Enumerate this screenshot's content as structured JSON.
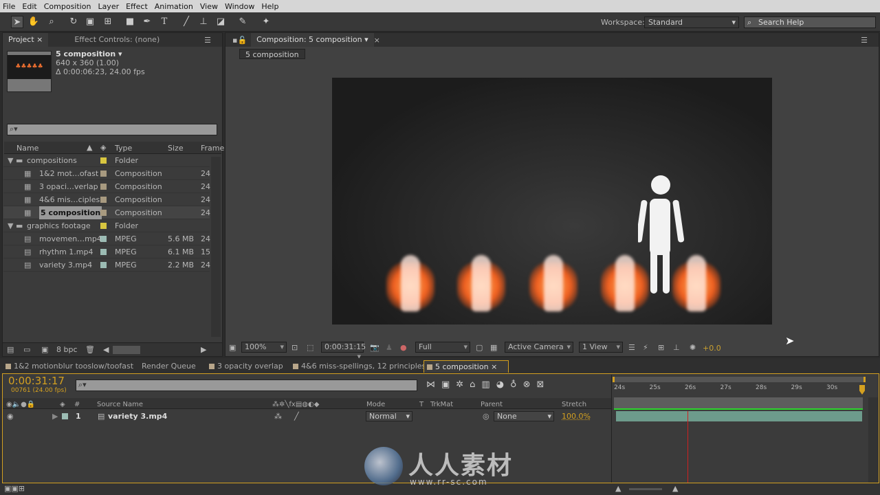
{
  "menu": [
    "File",
    "Edit",
    "Composition",
    "Layer",
    "Effect",
    "Animation",
    "View",
    "Window",
    "Help"
  ],
  "toolbar": {
    "workspace_label": "Workspace:",
    "workspace_value": "Standard",
    "search_placeholder": "Search Help"
  },
  "project_panel": {
    "tabs": [
      "Project",
      "Effect Controls: (none)"
    ],
    "selected_name": "5 composition ▾",
    "selected_dims": "640 x 360 (1.00)",
    "selected_duration": "Δ 0:00:06:23, 24.00 fps",
    "columns": [
      "Name",
      "Type",
      "Size",
      "Frame"
    ],
    "items": [
      {
        "name": "compositions",
        "type": "Folder",
        "size": "",
        "frame": "",
        "kind": "folder",
        "color": "#d8c640"
      },
      {
        "name": "1&2 mot…ofast",
        "type": "Composition",
        "size": "",
        "frame": "24",
        "kind": "comp",
        "color": "#a89a80"
      },
      {
        "name": "3 opaci…verlap",
        "type": "Composition",
        "size": "",
        "frame": "24",
        "kind": "comp",
        "color": "#a89a80"
      },
      {
        "name": "4&6 mis…ciples",
        "type": "Composition",
        "size": "",
        "frame": "24",
        "kind": "comp",
        "color": "#a89a80"
      },
      {
        "name": "5 composition",
        "type": "Composition",
        "size": "",
        "frame": "24",
        "kind": "comp",
        "color": "#a89a80",
        "selected": true
      },
      {
        "name": "graphics footage",
        "type": "Folder",
        "size": "",
        "frame": "",
        "kind": "folder",
        "color": "#d8c640"
      },
      {
        "name": "movemen…mp4",
        "type": "MPEG",
        "size": "5.6 MB",
        "frame": "24",
        "kind": "file",
        "color": "#9cbcb4"
      },
      {
        "name": "rhythm 1.mp4",
        "type": "MPEG",
        "size": "6.1 MB",
        "frame": "15",
        "kind": "file",
        "color": "#9cbcb4"
      },
      {
        "name": "variety 3.mp4",
        "type": "MPEG",
        "size": "2.2 MB",
        "frame": "24",
        "kind": "file",
        "color": "#9cbcb4"
      }
    ],
    "bpc": "8 bpc"
  },
  "viewer": {
    "tab": "Composition: 5 composition",
    "breadcrumb": "5 composition",
    "zoom": "100%",
    "timecode": "0:00:31:15",
    "resolution": "Full",
    "camera": "Active Camera",
    "views": "1 View",
    "exposure": "+0.0"
  },
  "timeline": {
    "tabs": [
      "1&2 motionblur tooslow/toofast",
      "Render Queue",
      "3 opacity overlap",
      "4&6 miss-spellings, 12 principles",
      "5 composition"
    ],
    "timecode": "0:00:31:17",
    "frames": "00761 (24.00 fps)",
    "columns": {
      "num": "#",
      "source": "Source Name",
      "mode": "Mode",
      "t": "T",
      "trkmat": "TrkMat",
      "parent": "Parent",
      "stretch": "Stretch"
    },
    "layers": [
      {
        "num": "1",
        "name": "variety 3.mp4",
        "mode": "Normal",
        "parent": "None",
        "stretch": "100.0%"
      }
    ],
    "ruler": [
      "24s",
      "25s",
      "26s",
      "27s",
      "28s",
      "29s",
      "30s"
    ],
    "accent": "#d4a020"
  },
  "watermark": {
    "text": "人人素材",
    "url": "www.rr-sc.com"
  }
}
